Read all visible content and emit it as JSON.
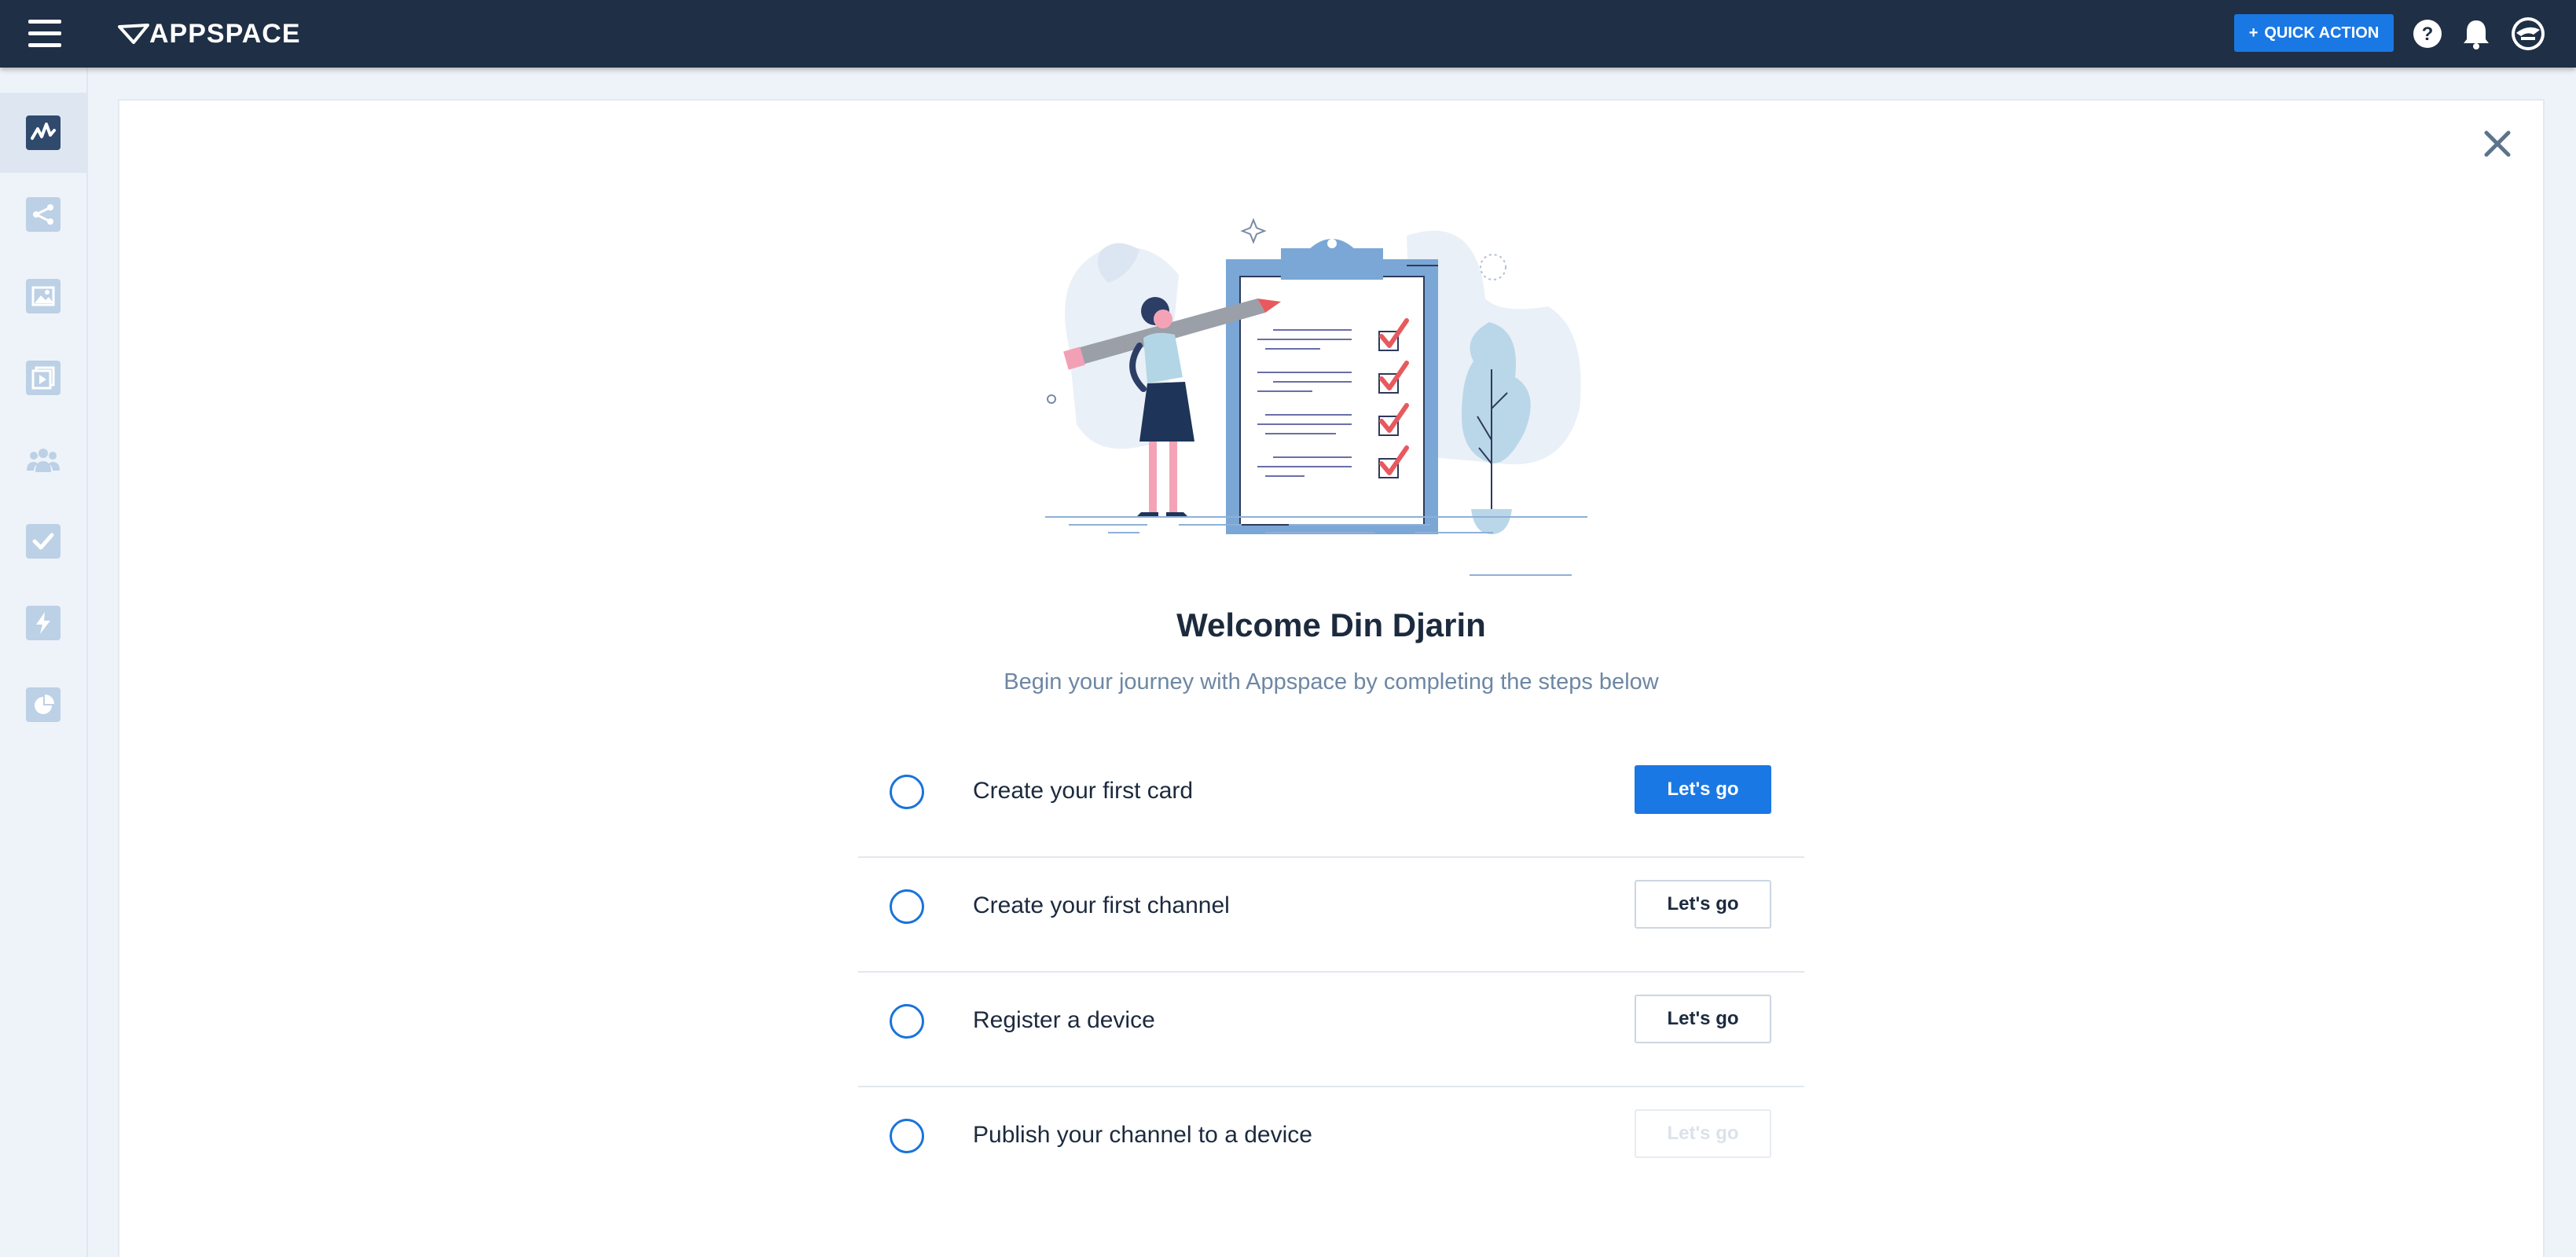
{
  "app": {
    "brand": "APPSPACE",
    "quick_action_label": "QUICK ACTION",
    "quick_action_prefix": "+"
  },
  "sidebar": {
    "items": [
      {
        "icon": "dashboard-activity-icon",
        "active": true
      },
      {
        "icon": "share-icon",
        "active": false
      },
      {
        "icon": "image-library-icon",
        "active": false
      },
      {
        "icon": "media-player-icon",
        "active": false
      },
      {
        "icon": "users-group-icon",
        "active": false
      },
      {
        "icon": "checkmark-tasks-icon",
        "active": false
      },
      {
        "icon": "lightning-icon",
        "active": false
      },
      {
        "icon": "analytics-pie-icon",
        "active": false
      }
    ]
  },
  "onboarding": {
    "title": "Welcome Din Djarin",
    "subtitle": "Begin your journey with Appspace by completing the steps below",
    "steps": [
      {
        "label": "Create your first card",
        "button": "Let's go",
        "state": "primary"
      },
      {
        "label": "Create your first channel",
        "button": "Let's go",
        "state": "secondary"
      },
      {
        "label": "Register a device",
        "button": "Let's go",
        "state": "secondary"
      },
      {
        "label": "Publish your channel to a device",
        "button": "Let's go",
        "state": "disabled"
      }
    ]
  },
  "colors": {
    "topbar": "#1f2f45",
    "accent": "#1a78e4",
    "sidebar_icon": "#bcd0e6",
    "sidebar_icon_active": "#2f4a6d"
  }
}
